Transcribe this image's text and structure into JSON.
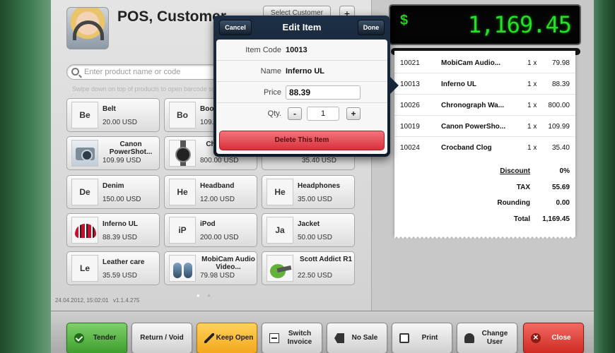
{
  "header": {
    "title": "POS, Customer",
    "select_customer_label": "Select Customer",
    "add_label": "+"
  },
  "search": {
    "placeholder": "Enter product name or code",
    "hint": "Swipe down on top of products to open barcode scanner"
  },
  "products": [
    {
      "abbr": "Be",
      "name": "Belt",
      "price": "20.00 USD"
    },
    {
      "abbr": "Bo",
      "name": "Boots",
      "price": "109.00 USD"
    },
    {
      "abbr": "",
      "image": "camera",
      "name": "Canon PowerShot...",
      "price": "109.99 USD"
    },
    {
      "abbr": "",
      "image": "watch",
      "name": "Chronograph",
      "price": "800.00 USD"
    },
    {
      "abbr": "",
      "name": "",
      "price": "35.40 USD"
    },
    {
      "abbr": "De",
      "name": "Denim",
      "price": "150.00 USD"
    },
    {
      "abbr": "He",
      "name": "Headband",
      "price": "12.00 USD"
    },
    {
      "abbr": "He",
      "name": "Headphones",
      "price": "35.00 USD"
    },
    {
      "abbr": "",
      "image": "helmet",
      "name": "Inferno UL",
      "price": "88.39 USD"
    },
    {
      "abbr": "iP",
      "name": "iPod",
      "price": "200.00 USD"
    },
    {
      "abbr": "Ja",
      "name": "Jacket",
      "price": "50.00 USD"
    },
    {
      "abbr": "Le",
      "name": "Leather care",
      "price": "35.59 USD"
    },
    {
      "abbr": "",
      "image": "speakers",
      "name": "MobiCam Audio Video...",
      "price": "79.98 USD"
    },
    {
      "abbr": "",
      "image": "yoga",
      "name": "Scott Addict R1",
      "price": "22.50 USD"
    }
  ],
  "footer": {
    "timestamp": "24.04.2012, 15:02:01",
    "version": "v1.1.4.275"
  },
  "total_display": {
    "currency_symbol": "$",
    "amount": "1,169.45"
  },
  "receipt": {
    "lines": [
      {
        "code": "10021",
        "name": "MobiCam Audio...",
        "qty": "1 x",
        "price": "79.98"
      },
      {
        "code": "10013",
        "name": "Inferno UL",
        "qty": "1 x",
        "price": "88.39"
      },
      {
        "code": "10026",
        "name": "Chronograph Wa...",
        "qty": "1 x",
        "price": "800.00"
      },
      {
        "code": "10019",
        "name": "Canon PowerSho...",
        "qty": "1 x",
        "price": "109.99"
      },
      {
        "code": "10024",
        "name": "Crocband Clog",
        "qty": "1 x",
        "price": "35.40"
      }
    ],
    "summary": [
      {
        "label": "Discount",
        "value": "0%"
      },
      {
        "label": "TAX",
        "value": "55.69"
      },
      {
        "label": "Rounding",
        "value": "0.00"
      },
      {
        "label": "Total",
        "value": "1,169.45"
      }
    ]
  },
  "edit_item": {
    "title": "Edit Item",
    "cancel_label": "Cancel",
    "done_label": "Done",
    "item_code_label": "Item Code",
    "item_code": "10013",
    "name_label": "Name",
    "name": "Inferno UL",
    "price_label": "Price",
    "price": "88.39",
    "qty_label": "Qty.",
    "qty": "1",
    "minus_label": "-",
    "plus_label": "+",
    "delete_label": "Delete This Item"
  },
  "toolbar": [
    {
      "name": "tender-button",
      "label": "Tender",
      "icon": "check-icon",
      "style": "green"
    },
    {
      "name": "return-void-button",
      "label": "Return / Void",
      "icon": "",
      "style": "gray"
    },
    {
      "name": "keep-open-button",
      "label": "Keep Open",
      "icon": "pencil-icon",
      "style": "yellow"
    },
    {
      "name": "switch-invoice-button",
      "label": "Switch Invoice",
      "icon": "switch-icon",
      "style": "gray"
    },
    {
      "name": "no-sale-button",
      "label": "No Sale",
      "icon": "no-sale-icon",
      "style": "gray"
    },
    {
      "name": "print-button",
      "label": "Print",
      "icon": "printer-icon",
      "style": "gray"
    },
    {
      "name": "change-user-button",
      "label": "Change User",
      "icon": "user-icon",
      "style": "gray"
    },
    {
      "name": "close-button",
      "label": "Close",
      "icon": "close-icon",
      "style": "red"
    }
  ],
  "colors": {
    "display_green": "#22e022",
    "tender_green": "#3e9e2e",
    "keep_open_yellow": "#f3a81e",
    "close_red": "#cf2a22",
    "delete_red": "#d8303a"
  }
}
